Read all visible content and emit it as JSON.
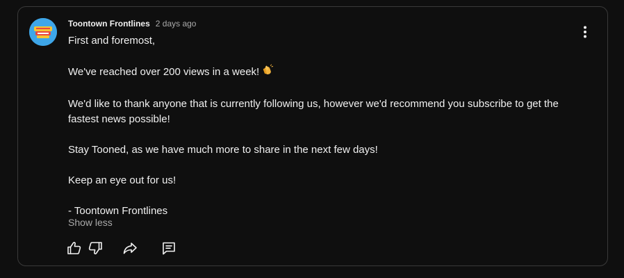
{
  "post": {
    "author": "Toontown Frontlines",
    "time": "2 days ago",
    "paragraphs": [
      "First and foremost,",
      "We've reached over 200 views in a week!",
      "We'd like to thank anyone that is currently following us, however we'd recommend you subscribe to get the fastest news possible!",
      "Stay Tooned, as we have much more to share in the next few days!",
      "Keep an eye out for us!",
      "- Toontown Frontlines"
    ],
    "emoji_icon": "clapping-hands-icon",
    "show_less_label": "Show less"
  },
  "actions": {
    "icons": [
      "thumbs-up-icon",
      "thumbs-down-icon",
      "share-icon",
      "comment-icon"
    ]
  },
  "colors": {
    "background": "#0f0f0f",
    "border": "#3a3a3a",
    "text_primary": "#f1f1f1",
    "text_secondary": "#aaaaaa",
    "avatar_bg": "#3ea6e8"
  }
}
